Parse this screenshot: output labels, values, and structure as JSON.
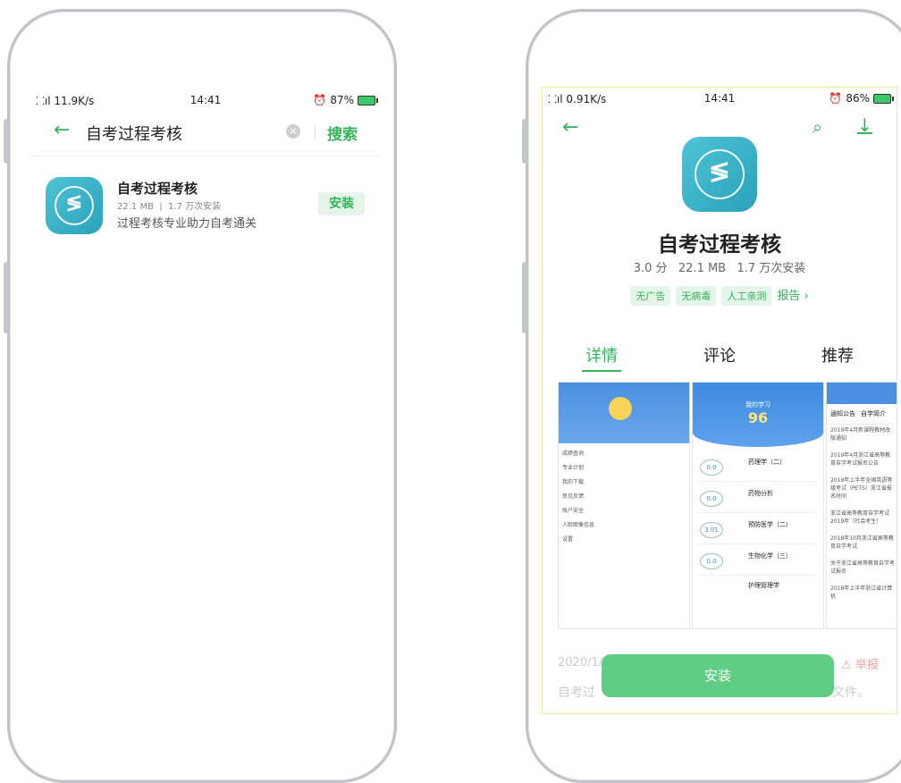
{
  "left": {
    "status": {
      "network": "⸬ıl 11.9K/s",
      "time": "14:41",
      "battery": "87%"
    },
    "search_query": "自考过程考核",
    "search_button": "搜索",
    "result": {
      "name": "自考过程考核",
      "meta": "22.1 MB  |  1.7 万次安装",
      "desc": "过程考核专业助力自考通关",
      "install": "安装"
    }
  },
  "right": {
    "status": {
      "network": "⸬ıl 0.91K/s",
      "time": "14:41",
      "battery": "86%"
    },
    "app_name": "自考过程考核",
    "stats": "3.0 分   22.1 MB   1.7 万次安装",
    "tags": [
      "无广告",
      "无病毒",
      "人工亲测"
    ],
    "report": "报告 ›",
    "tabs": [
      "详情",
      "评论",
      "推荐"
    ],
    "date": "2020/1/",
    "desc_start": "自考过",
    "desc_end": "文件。",
    "report_link": "⚠ 举报",
    "install": "安装",
    "shot1": {
      "menu": [
        "成绩查询",
        "专业计划",
        "我的下载",
        "意见反馈",
        "账户安全",
        "人脸图像信息",
        "设置"
      ]
    },
    "shot2": {
      "title": "我的学习",
      "days": "96",
      "courses": [
        {
          "score": "0.0",
          "name": "药理学（二）"
        },
        {
          "score": "0.0",
          "name": "药物分析"
        },
        {
          "score": "3.01",
          "name": "预防医学（二）"
        },
        {
          "score": "0.0",
          "name": "生物化学（三）"
        },
        {
          "score": "",
          "name": "护理管理学"
        }
      ]
    },
    "shot3": {
      "tabs": [
        "通知公告",
        "自学简介"
      ],
      "items": [
        "2019年4月新课程教材改版通知",
        "2019年4月浙江省高等教育自学考试报名公告",
        "2019年上半年全国英语等级考试（PETS）浙江省报名时间",
        "浙江省高等教育自学考试2019年（社会考生）",
        "2018年10月浙江省高等教育自学考试",
        "关于浙江省高等教育自学考试报名",
        "2018年上半年浙江省计算机"
      ]
    }
  }
}
